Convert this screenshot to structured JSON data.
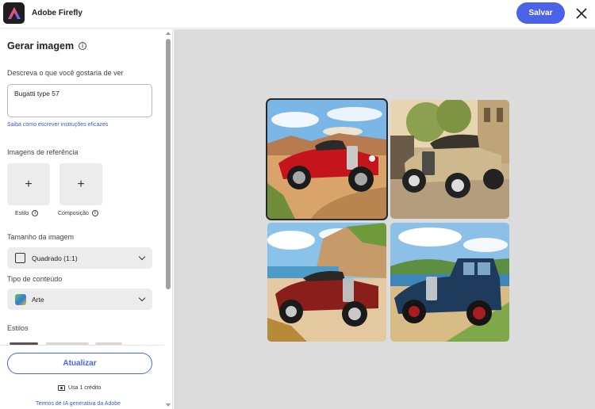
{
  "header": {
    "app_title": "Adobe Firefly",
    "save_label": "Salvar",
    "close_icon": "close-icon",
    "logo_icon": "adobe-firefly-logo"
  },
  "sidebar": {
    "title": "Gerar imagem",
    "prompt": {
      "label": "Descreva o que você gostaria de ver",
      "value": "Bugatti type 57",
      "help_link": "Saiba como escrever instruções eficazes"
    },
    "reference": {
      "label": "Imagens de referência",
      "tiles": [
        {
          "label": "Estilo"
        },
        {
          "label": "Composição"
        }
      ]
    },
    "image_size": {
      "label": "Tamanho da imagem",
      "value": "Quadrado (1:1)"
    },
    "content_type": {
      "label": "Tipo de conteúdo",
      "value": "Arte"
    },
    "styles_label": "Estilos",
    "update_label": "Atualizar",
    "credit_text": "Usa 1 crédito",
    "terms_link": "Termos de IA generativa da Adobe"
  },
  "results": {
    "selected_index": 0,
    "images": [
      {
        "subject": "red vintage roadster on sunny dirt road"
      },
      {
        "subject": "cream vintage car on city street"
      },
      {
        "subject": "red vintage roadster by coastal cliffs"
      },
      {
        "subject": "dark blue vintage coupe on coastal road"
      }
    ]
  },
  "colors": {
    "accent": "#4b63e6",
    "canvas_bg": "#dcdcdc"
  }
}
